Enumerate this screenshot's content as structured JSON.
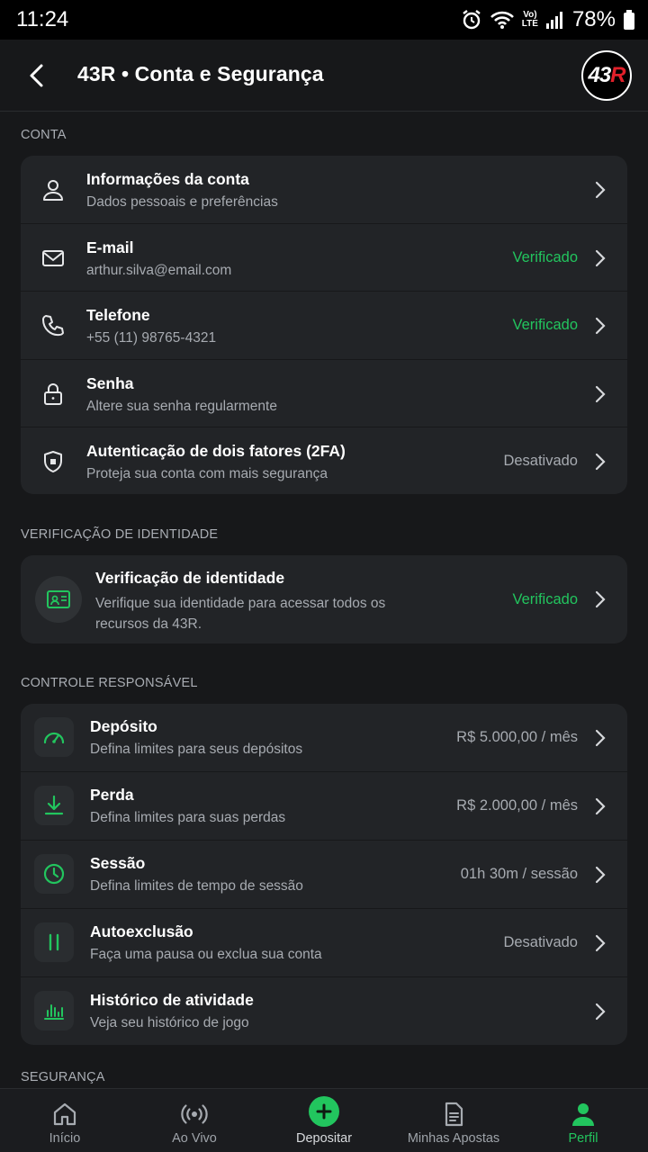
{
  "status_bar": {
    "time": "11:24",
    "battery": "78%",
    "lte_top": "Vo)",
    "lte_bottom": "LTE"
  },
  "header": {
    "title": "43R • Conta e Segurança",
    "logo_left": "43",
    "logo_right": "R"
  },
  "sections": {
    "conta": "CONTA",
    "verificacao": "VERIFICAÇÃO DE IDENTIDADE",
    "controle": "CONTROLE RESPONSÁVEL",
    "seguranca": "SEGURANÇA"
  },
  "conta_items": [
    {
      "title": "Informações da conta",
      "subtitle": "Dados pessoais e preferências",
      "value": "",
      "icon": "user-icon"
    },
    {
      "title": "E-mail",
      "subtitle": "arthur.silva@email.com",
      "value": "Verificado",
      "icon": "mail-icon"
    },
    {
      "title": "Telefone",
      "subtitle": "+55 (11) 98765-4321",
      "value": "Verificado",
      "icon": "phone-icon"
    },
    {
      "title": "Senha",
      "subtitle": "Altere sua senha regularmente",
      "value": "",
      "icon": "lock-icon"
    },
    {
      "title": "Autenticação de dois fatores (2FA)",
      "subtitle": "Proteja sua conta com mais segurança",
      "value": "Desativado",
      "icon": "shield-icon"
    }
  ],
  "identity": {
    "title": "Verificação de identidade",
    "subtitle": "Verifique sua identidade para acessar todos os recursos da 43R.",
    "value": "Verificado",
    "icon": "id-card-icon"
  },
  "controle_items": [
    {
      "title": "Depósito",
      "subtitle": "Defina limites para seus depósitos",
      "value": "R$ 5.000,00 / mês",
      "icon": "gauge-icon"
    },
    {
      "title": "Perda",
      "subtitle": "Defina limites para suas perdas",
      "value": "R$ 2.000,00 / mês",
      "icon": "download-icon"
    },
    {
      "title": "Sessão",
      "subtitle": "Defina limites de tempo de sessão",
      "value": "01h 30m / sessão",
      "icon": "clock-icon"
    },
    {
      "title": "Autoexclusão",
      "subtitle": "Faça uma pausa ou exclua sua conta",
      "value": "Desativado",
      "icon": "pause-icon"
    },
    {
      "title": "Histórico de atividade",
      "subtitle": "Veja seu histórico de jogo",
      "value": "",
      "icon": "bar-chart-icon"
    }
  ],
  "nav": [
    {
      "label": "Início",
      "icon": "home-icon"
    },
    {
      "label": "Ao Vivo",
      "icon": "broadcast-icon"
    },
    {
      "label": "Depositar",
      "icon": "plus-icon"
    },
    {
      "label": "Minhas Apostas",
      "icon": "document-icon"
    },
    {
      "label": "Perfil",
      "icon": "profile-icon",
      "active": true
    }
  ],
  "colors": {
    "accent": "#22c55e",
    "background": "#17181a",
    "card": "#222427",
    "brand_red": "#e0202a"
  }
}
